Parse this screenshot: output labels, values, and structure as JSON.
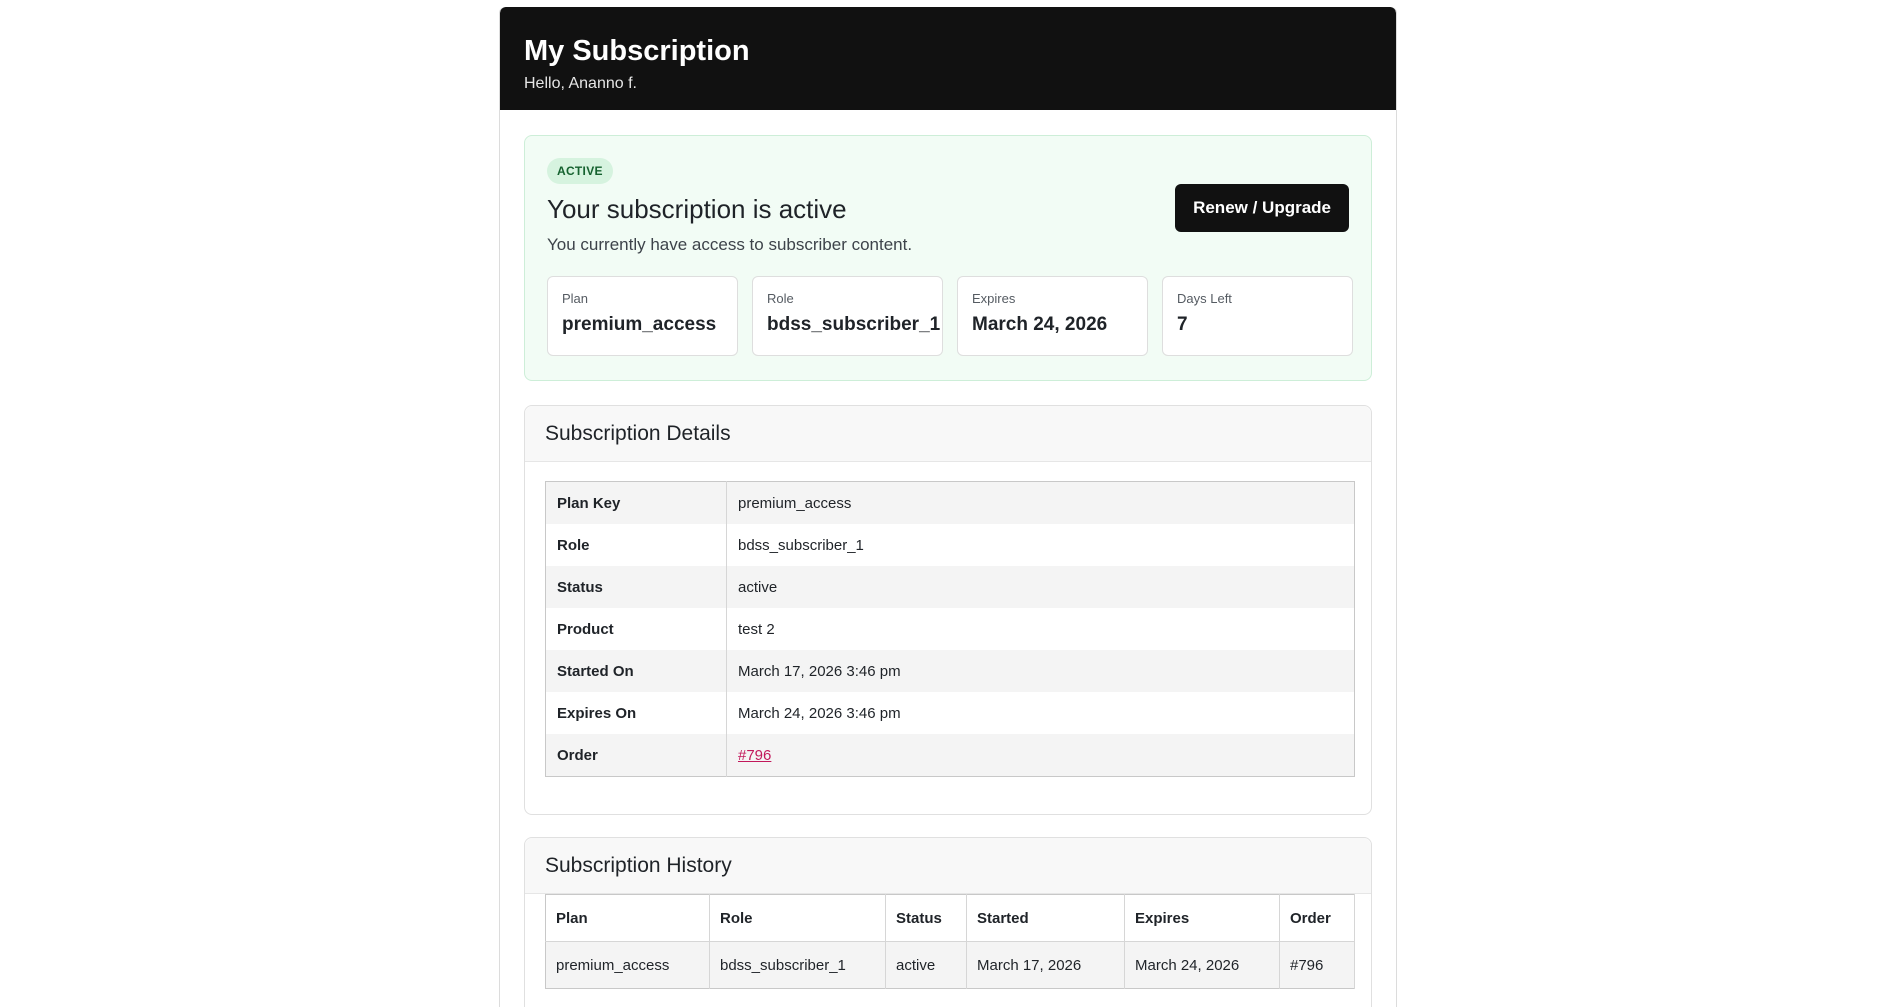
{
  "header": {
    "title": "My Subscription",
    "greeting": "Hello, Ananno f."
  },
  "status": {
    "badge": "ACTIVE",
    "title": "Your subscription is active",
    "description": "You currently have access to subscriber content.",
    "button": "Renew / Upgrade",
    "stats": [
      {
        "label": "Plan",
        "value": "premium_access"
      },
      {
        "label": "Role",
        "value": "bdss_subscriber_1"
      },
      {
        "label": "Expires",
        "value": "March 24, 2026"
      },
      {
        "label": "Days Left",
        "value": "7"
      }
    ]
  },
  "details": {
    "title": "Subscription Details",
    "rows": [
      {
        "key": "Plan Key",
        "value": "premium_access"
      },
      {
        "key": "Role",
        "value": "bdss_subscriber_1"
      },
      {
        "key": "Status",
        "value": "active"
      },
      {
        "key": "Product",
        "value": "test 2"
      },
      {
        "key": "Started On",
        "value": "March 17, 2026 3:46 pm"
      },
      {
        "key": "Expires On",
        "value": "March 24, 2026 3:46 pm"
      },
      {
        "key": "Order",
        "value": "#796"
      }
    ]
  },
  "history": {
    "title": "Subscription History",
    "columns": [
      "Plan",
      "Role",
      "Status",
      "Started",
      "Expires",
      "Order"
    ],
    "rows": [
      [
        "premium_access",
        "bdss_subscriber_1",
        "active",
        "March 17, 2026",
        "March 24, 2026",
        "#796"
      ]
    ]
  },
  "colors": {
    "header_bg": "#111111",
    "active_card_bg": "#f2fcf5",
    "badge_text": "#15622f",
    "link": "#c2185b"
  }
}
